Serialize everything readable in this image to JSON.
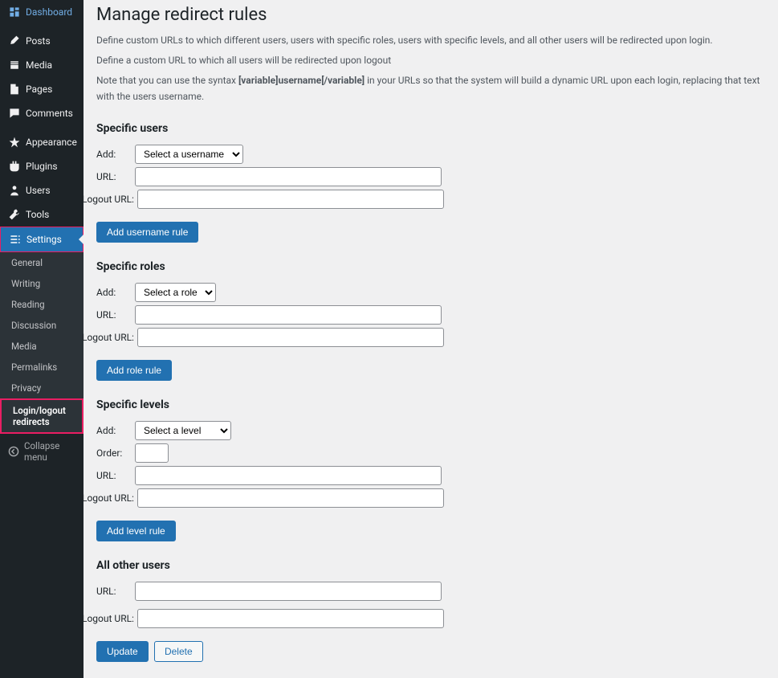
{
  "sidebar": {
    "items": [
      {
        "label": "Dashboard",
        "icon": "dashboard"
      },
      {
        "label": "Posts",
        "icon": "pin"
      },
      {
        "label": "Media",
        "icon": "media"
      },
      {
        "label": "Pages",
        "icon": "pages"
      },
      {
        "label": "Comments",
        "icon": "comments"
      },
      {
        "label": "Appearance",
        "icon": "appearance"
      },
      {
        "label": "Plugins",
        "icon": "plugins"
      },
      {
        "label": "Users",
        "icon": "users"
      },
      {
        "label": "Tools",
        "icon": "tools"
      },
      {
        "label": "Settings",
        "icon": "settings"
      }
    ],
    "submenu": [
      {
        "label": "General"
      },
      {
        "label": "Writing"
      },
      {
        "label": "Reading"
      },
      {
        "label": "Discussion"
      },
      {
        "label": "Media"
      },
      {
        "label": "Permalinks"
      },
      {
        "label": "Privacy"
      },
      {
        "label": "Login/logout redirects"
      }
    ],
    "collapse": "Collapse menu"
  },
  "page": {
    "title": "Manage redirect rules",
    "desc1": "Define custom URLs to which different users, users with specific roles, users with specific levels, and all other users will be redirected upon login.",
    "desc2": "Define a custom URL to which all users will be redirected upon logout",
    "desc3_a": "Note that you can use the syntax ",
    "desc3_b": "[variable]username[/variable]",
    "desc3_c": " in your URLs so that the system will build a dynamic URL upon each login, replacing that text with the users username."
  },
  "sections": {
    "users": {
      "heading": "Specific users",
      "add_label": "Add:",
      "select_placeholder": "Select a username",
      "url_label": "URL:",
      "logout_label": "Logout URL:",
      "button": "Add username rule"
    },
    "roles": {
      "heading": "Specific roles",
      "add_label": "Add:",
      "select_placeholder": "Select a role",
      "url_label": "URL:",
      "logout_label": "Logout URL:",
      "button": "Add role rule"
    },
    "levels": {
      "heading": "Specific levels",
      "add_label": "Add:",
      "select_placeholder": "Select a level",
      "order_label": "Order:",
      "url_label": "URL:",
      "logout_label": "Logout URL:",
      "button": "Add level rule"
    },
    "others": {
      "heading": "All other users",
      "url_label": "URL:",
      "logout_label": "Logout URL:"
    },
    "actions": {
      "update": "Update",
      "delete": "Delete"
    }
  }
}
